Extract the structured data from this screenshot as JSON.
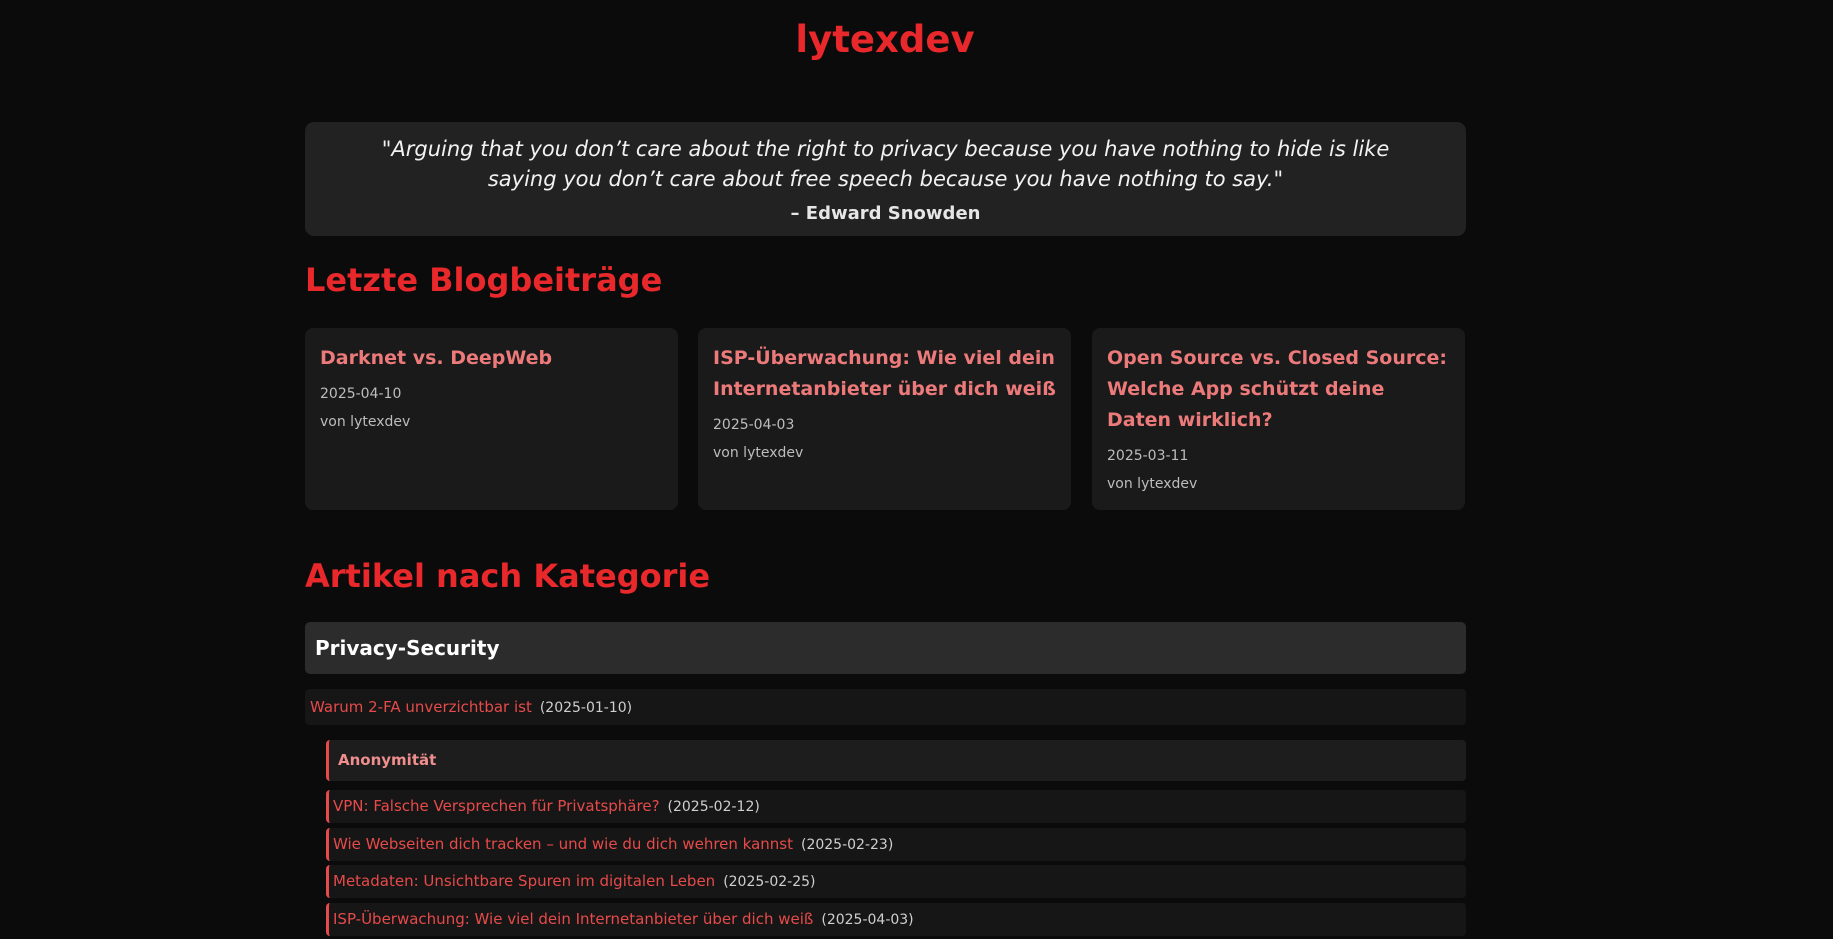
{
  "site": {
    "title": "lytexdev"
  },
  "quote": {
    "text": "\"Arguing that you don’t care about the right to privacy because you have nothing to hide is like saying you don’t care about free speech because you have nothing to say.\"",
    "author": "– Edward Snowden"
  },
  "recent_posts": {
    "heading": "Letzte Blogbeiträge",
    "items": [
      {
        "title": "Darknet vs. DeepWeb",
        "date": "2025-04-10",
        "author": "von lytexdev"
      },
      {
        "title": "ISP-Überwachung: Wie viel dein Internetanbieter über dich weiß",
        "date": "2025-04-03",
        "author": "von lytexdev"
      },
      {
        "title": "Open Source vs. Closed Source: Welche App schützt deine Daten wirklich?",
        "date": "2025-03-11",
        "author": "von lytexdev"
      }
    ]
  },
  "categories": {
    "heading": "Artikel nach Kategorie",
    "items": [
      {
        "name": "Privacy-Security",
        "articles": [
          {
            "title": "Warum 2-FA unverzichtbar ist",
            "date": "(2025-01-10)"
          }
        ],
        "subcategories": [
          {
            "name": "Anonymität",
            "articles": [
              {
                "title": "VPN: Falsche Versprechen für Privatsphäre?",
                "date": "(2025-02-12)"
              },
              {
                "title": "Wie Webseiten dich tracken – und wie du dich wehren kannst",
                "date": "(2025-02-23)"
              },
              {
                "title": "Metadaten: Unsichtbare Spuren im digitalen Leben",
                "date": "(2025-02-25)"
              },
              {
                "title": "ISP-Überwachung: Wie viel dein Internetanbieter über dich weiß",
                "date": "(2025-04-03)"
              }
            ]
          }
        ]
      }
    ]
  },
  "colors": {
    "accent": "#e8282b",
    "link": "#e74a4a",
    "background": "#0b0b0b"
  }
}
